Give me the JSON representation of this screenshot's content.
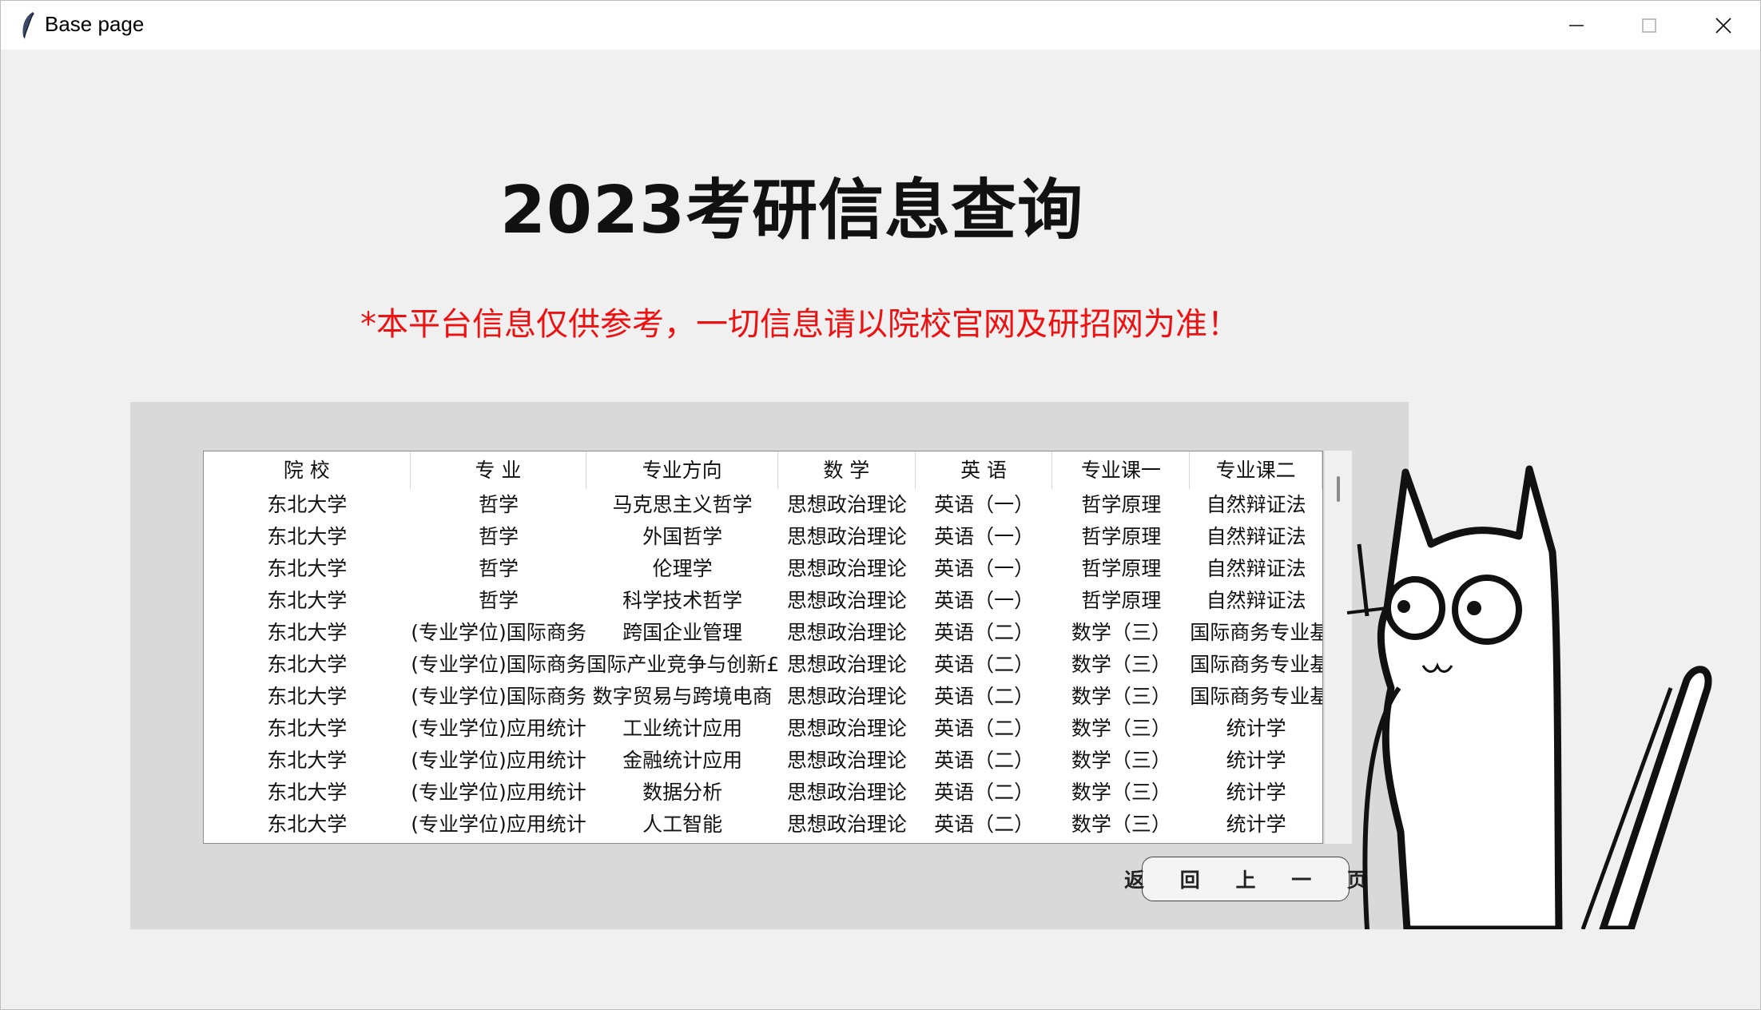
{
  "window": {
    "title": "Base page",
    "controls": [
      "minimize-icon",
      "maximize-icon",
      "close-icon"
    ]
  },
  "main_title": "2023考研信息查询",
  "disclaimer": "*本平台信息仅供参考，一切信息请以院校官网及研招网为准！",
  "colors": {
    "disclaimer": "#ee1111",
    "panel": "#d9d9d9",
    "background": "#f0f0f0"
  },
  "table": {
    "columns": [
      "院  校",
      "专  业",
      "专业方向",
      "数  学",
      "英  语",
      "专业课一",
      "专业课二"
    ],
    "rows": [
      [
        "东北大学",
        "哲学",
        "马克思主义哲学",
        "思想政治理论",
        "英语（一）",
        "哲学原理",
        "自然辩证法"
      ],
      [
        "东北大学",
        "哲学",
        "外国哲学",
        "思想政治理论",
        "英语（一）",
        "哲学原理",
        "自然辩证法"
      ],
      [
        "东北大学",
        "哲学",
        "伦理学",
        "思想政治理论",
        "英语（一）",
        "哲学原理",
        "自然辩证法"
      ],
      [
        "东北大学",
        "哲学",
        "科学技术哲学",
        "思想政治理论",
        "英语（一）",
        "哲学原理",
        "自然辩证法"
      ],
      [
        "东北大学",
        "(专业学位)国际商务",
        "跨国企业管理",
        "思想政治理论",
        "英语（二）",
        "数学（三）",
        "国际商务专业基"
      ],
      [
        "东北大学",
        "(专业学位)国际商务",
        "国际产业竞争与创新£",
        "思想政治理论",
        "英语（二）",
        "数学（三）",
        "国际商务专业基"
      ],
      [
        "东北大学",
        "(专业学位)国际商务",
        "数字贸易与跨境电商",
        "思想政治理论",
        "英语（二）",
        "数学（三）",
        "国际商务专业基"
      ],
      [
        "东北大学",
        "(专业学位)应用统计",
        "工业统计应用",
        "思想政治理论",
        "英语（二）",
        "数学（三）",
        "统计学"
      ],
      [
        "东北大学",
        "(专业学位)应用统计",
        "金融统计应用",
        "思想政治理论",
        "英语（二）",
        "数学（三）",
        "统计学"
      ],
      [
        "东北大学",
        "(专业学位)应用统计",
        "数据分析",
        "思想政治理论",
        "英语（二）",
        "数学（三）",
        "统计学"
      ],
      [
        "东北大学",
        "(专业学位)应用统计",
        "人工智能",
        "思想政治理论",
        "英语（二）",
        "数学（三）",
        "统计学"
      ]
    ]
  },
  "back_button": "返 回 上 一 页",
  "mascot": "cat-illustration"
}
